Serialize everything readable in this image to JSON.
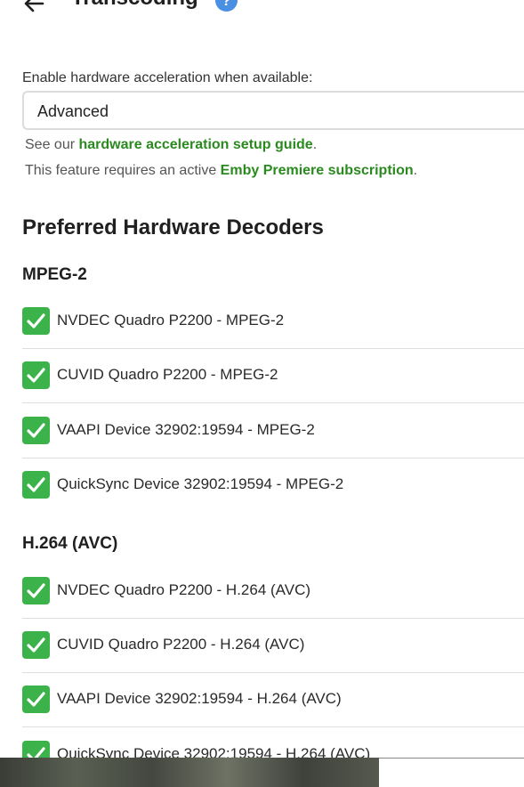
{
  "header": {
    "title": "Transcoding",
    "help_symbol": "?"
  },
  "hw_accel": {
    "label": "Enable hardware acceleration when available:",
    "value": "Advanced",
    "guide_prefix": "See our ",
    "guide_link": "hardware acceleration setup guide",
    "guide_suffix": ".",
    "premiere_prefix": "This feature requires an active ",
    "premiere_link": "Emby Premiere subscription",
    "premiere_suffix": "."
  },
  "decoders": {
    "section_title": "Preferred Hardware Decoders",
    "groups": [
      {
        "heading": "MPEG-2",
        "items": [
          {
            "label": "NVDEC Quadro P2200 - MPEG-2",
            "checked": true
          },
          {
            "label": "CUVID Quadro P2200 - MPEG-2",
            "checked": true
          },
          {
            "label": "VAAPI Device 32902:19594 - MPEG-2",
            "checked": true
          },
          {
            "label": "QuickSync Device 32902:19594 - MPEG-2",
            "checked": true
          }
        ]
      },
      {
        "heading": "H.264 (AVC)",
        "items": [
          {
            "label": "NVDEC Quadro P2200 - H.264 (AVC)",
            "checked": true
          },
          {
            "label": "CUVID Quadro P2200 - H.264 (AVC)",
            "checked": true
          },
          {
            "label": "VAAPI Device 32902:19594 - H.264 (AVC)",
            "checked": true
          },
          {
            "label": "QuickSync Device 32902:19594 - H.264 (AVC)",
            "checked": true
          }
        ]
      }
    ]
  },
  "colors": {
    "accent_green": "#3cb34a",
    "link_green": "#2a8a1f",
    "help_blue": "#4a90e2"
  },
  "icons": {
    "back": "arrow-left-icon",
    "help": "question-circle-icon",
    "check": "checkmark-icon"
  }
}
